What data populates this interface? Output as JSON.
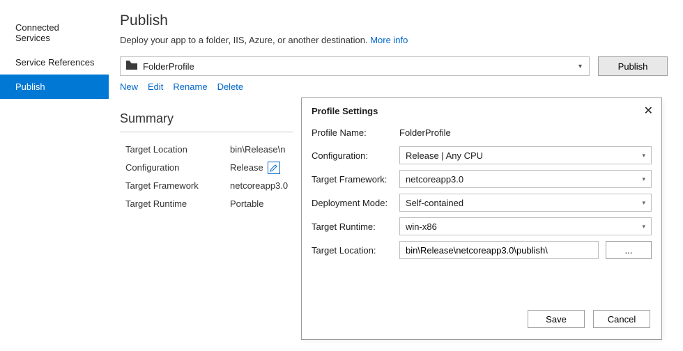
{
  "sidebar": {
    "items": [
      {
        "label": "Connected Services"
      },
      {
        "label": "Service References"
      },
      {
        "label": "Publish"
      }
    ]
  },
  "page": {
    "title": "Publish",
    "subtitle": "Deploy your app to a folder, IIS, Azure, or another destination.",
    "moreinfo": "More info"
  },
  "profile": {
    "selected": "FolderProfile",
    "publish_button": "Publish",
    "links": {
      "new": "New",
      "edit": "Edit",
      "rename": "Rename",
      "delete": "Delete"
    }
  },
  "summary": {
    "heading": "Summary",
    "rows": {
      "target_location": {
        "label": "Target Location",
        "value": "bin\\Release\\n"
      },
      "configuration": {
        "label": "Configuration",
        "value": "Release"
      },
      "target_framework": {
        "label": "Target Framework",
        "value": "netcoreapp3.0"
      },
      "target_runtime": {
        "label": "Target Runtime",
        "value": "Portable"
      }
    }
  },
  "dialog": {
    "title": "Profile Settings",
    "fields": {
      "profile_name": {
        "label": "Profile Name:",
        "value": "FolderProfile"
      },
      "configuration": {
        "label": "Configuration:",
        "value": "Release | Any CPU"
      },
      "target_framework": {
        "label": "Target Framework:",
        "value": "netcoreapp3.0"
      },
      "deployment_mode": {
        "label": "Deployment Mode:",
        "value": "Self-contained"
      },
      "target_runtime": {
        "label": "Target Runtime:",
        "value": "win-x86"
      },
      "target_location": {
        "label": "Target Location:",
        "value": "bin\\Release\\netcoreapp3.0\\publish\\"
      }
    },
    "browse": "...",
    "save": "Save",
    "cancel": "Cancel"
  }
}
